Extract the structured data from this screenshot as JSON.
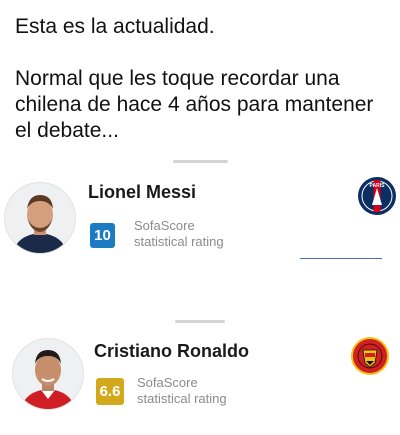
{
  "post": {
    "line1": "Esta es la actualidad.",
    "line2": "Normal que les toque recordar una chilena de hace 4 años para mantener el debate..."
  },
  "players": [
    {
      "name": "Lionel Messi",
      "rating": "10",
      "rating_color": "#1d7cc1",
      "source_label": "SofaScore",
      "rating_label": "statistical rating",
      "club_icon": "psg-crest-icon",
      "club_text": "PARIS"
    },
    {
      "name": "Cristiano Ronaldo",
      "rating": "6.6",
      "rating_color": "#d2a91a",
      "source_label": "SofaScore",
      "rating_label": "statistical rating",
      "club_icon": "manchester-united-crest-icon"
    }
  ],
  "colors": {
    "psg_blue": "#0b2e63",
    "psg_red": "#d6001c",
    "manutd_red": "#d21f1f",
    "manutd_gold": "#f4c21b"
  }
}
